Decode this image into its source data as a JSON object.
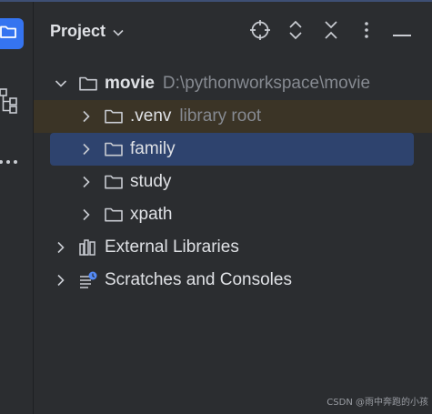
{
  "panel": {
    "title": "Project"
  },
  "tree": {
    "root": {
      "name": "movie",
      "path": "D:\\pythonworkspace\\movie"
    },
    "folders": [
      {
        "name": ".venv",
        "hint": "library root"
      },
      {
        "name": "family"
      },
      {
        "name": "study"
      },
      {
        "name": "xpath"
      }
    ],
    "external_libraries": "External Libraries",
    "scratches": "Scratches and Consoles"
  },
  "watermark": "CSDN @雨中奔跑的小孩",
  "colors": {
    "accent": "#3574f0",
    "selection": "#2e436e",
    "excluded_bg": "#3b3426"
  },
  "icons": [
    "folder-icon",
    "structure-icon",
    "more-icon",
    "chevron-down-icon",
    "locate-icon",
    "expand-all-icon",
    "collapse-all-icon",
    "options-icon",
    "minimize-icon",
    "chevron-right-icon",
    "libraries-icon",
    "scratches-icon"
  ]
}
